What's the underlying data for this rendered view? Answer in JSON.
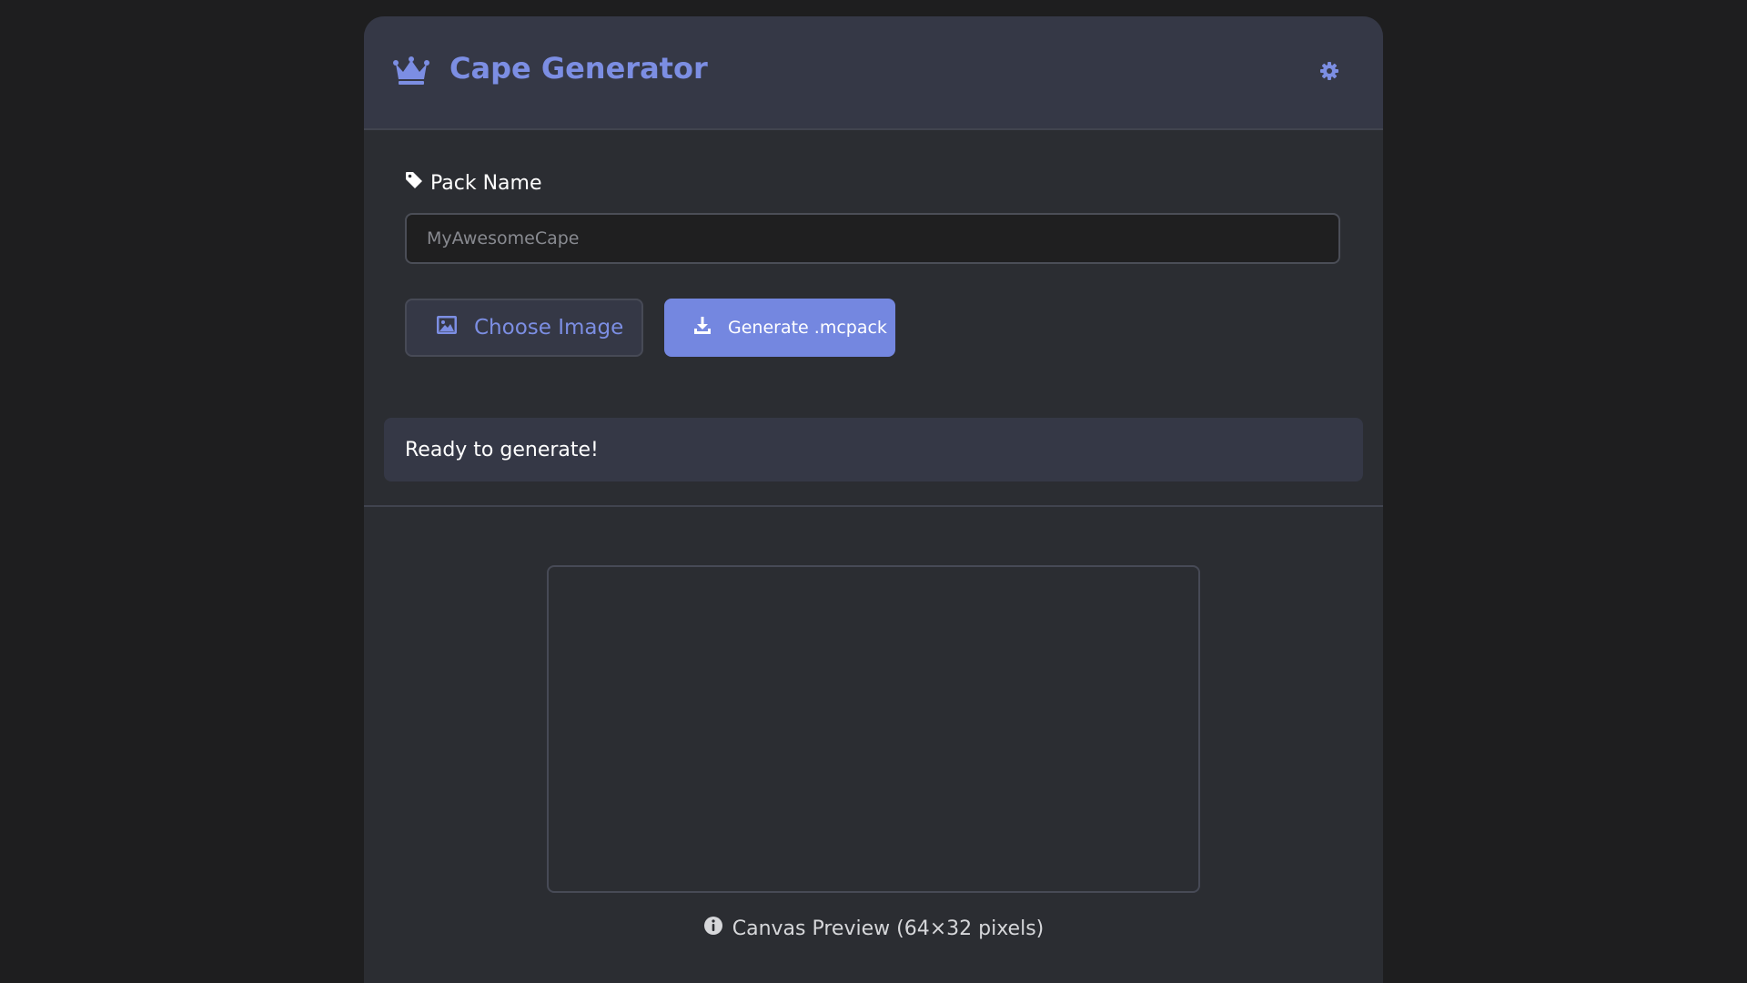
{
  "header": {
    "title": "Cape Generator",
    "icon": "crown-icon",
    "settings_icon": "gear-icon"
  },
  "form": {
    "pack_name_label": "Pack Name",
    "pack_name_icon": "tag-icon",
    "pack_name_value": "",
    "pack_name_placeholder": "MyAwesomeCape",
    "choose_image_label": "Choose Image",
    "choose_image_icon": "image-icon",
    "generate_label": "Generate .mcpack",
    "generate_icon": "download-icon"
  },
  "status": {
    "message": "Ready to generate!"
  },
  "preview": {
    "caption": "Canvas Preview (64×32 pixels)",
    "caption_icon": "info-icon"
  },
  "colors": {
    "accent": "#7c8ee3",
    "background": "#1e1e1f",
    "card": "#2b2d32",
    "header": "#353846"
  }
}
